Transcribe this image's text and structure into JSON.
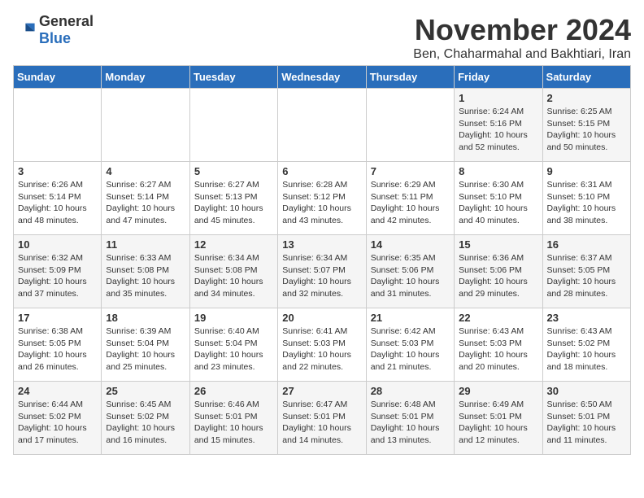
{
  "header": {
    "logo_general": "General",
    "logo_blue": "Blue",
    "title": "November 2024",
    "subtitle": "Ben, Chaharmahal and Bakhtiari, Iran"
  },
  "weekdays": [
    "Sunday",
    "Monday",
    "Tuesday",
    "Wednesday",
    "Thursday",
    "Friday",
    "Saturday"
  ],
  "weeks": [
    [
      {
        "day": "",
        "info": ""
      },
      {
        "day": "",
        "info": ""
      },
      {
        "day": "",
        "info": ""
      },
      {
        "day": "",
        "info": ""
      },
      {
        "day": "",
        "info": ""
      },
      {
        "day": "1",
        "info": "Sunrise: 6:24 AM\nSunset: 5:16 PM\nDaylight: 10 hours and 52 minutes."
      },
      {
        "day": "2",
        "info": "Sunrise: 6:25 AM\nSunset: 5:15 PM\nDaylight: 10 hours and 50 minutes."
      }
    ],
    [
      {
        "day": "3",
        "info": "Sunrise: 6:26 AM\nSunset: 5:14 PM\nDaylight: 10 hours and 48 minutes."
      },
      {
        "day": "4",
        "info": "Sunrise: 6:27 AM\nSunset: 5:14 PM\nDaylight: 10 hours and 47 minutes."
      },
      {
        "day": "5",
        "info": "Sunrise: 6:27 AM\nSunset: 5:13 PM\nDaylight: 10 hours and 45 minutes."
      },
      {
        "day": "6",
        "info": "Sunrise: 6:28 AM\nSunset: 5:12 PM\nDaylight: 10 hours and 43 minutes."
      },
      {
        "day": "7",
        "info": "Sunrise: 6:29 AM\nSunset: 5:11 PM\nDaylight: 10 hours and 42 minutes."
      },
      {
        "day": "8",
        "info": "Sunrise: 6:30 AM\nSunset: 5:10 PM\nDaylight: 10 hours and 40 minutes."
      },
      {
        "day": "9",
        "info": "Sunrise: 6:31 AM\nSunset: 5:10 PM\nDaylight: 10 hours and 38 minutes."
      }
    ],
    [
      {
        "day": "10",
        "info": "Sunrise: 6:32 AM\nSunset: 5:09 PM\nDaylight: 10 hours and 37 minutes."
      },
      {
        "day": "11",
        "info": "Sunrise: 6:33 AM\nSunset: 5:08 PM\nDaylight: 10 hours and 35 minutes."
      },
      {
        "day": "12",
        "info": "Sunrise: 6:34 AM\nSunset: 5:08 PM\nDaylight: 10 hours and 34 minutes."
      },
      {
        "day": "13",
        "info": "Sunrise: 6:34 AM\nSunset: 5:07 PM\nDaylight: 10 hours and 32 minutes."
      },
      {
        "day": "14",
        "info": "Sunrise: 6:35 AM\nSunset: 5:06 PM\nDaylight: 10 hours and 31 minutes."
      },
      {
        "day": "15",
        "info": "Sunrise: 6:36 AM\nSunset: 5:06 PM\nDaylight: 10 hours and 29 minutes."
      },
      {
        "day": "16",
        "info": "Sunrise: 6:37 AM\nSunset: 5:05 PM\nDaylight: 10 hours and 28 minutes."
      }
    ],
    [
      {
        "day": "17",
        "info": "Sunrise: 6:38 AM\nSunset: 5:05 PM\nDaylight: 10 hours and 26 minutes."
      },
      {
        "day": "18",
        "info": "Sunrise: 6:39 AM\nSunset: 5:04 PM\nDaylight: 10 hours and 25 minutes."
      },
      {
        "day": "19",
        "info": "Sunrise: 6:40 AM\nSunset: 5:04 PM\nDaylight: 10 hours and 23 minutes."
      },
      {
        "day": "20",
        "info": "Sunrise: 6:41 AM\nSunset: 5:03 PM\nDaylight: 10 hours and 22 minutes."
      },
      {
        "day": "21",
        "info": "Sunrise: 6:42 AM\nSunset: 5:03 PM\nDaylight: 10 hours and 21 minutes."
      },
      {
        "day": "22",
        "info": "Sunrise: 6:43 AM\nSunset: 5:03 PM\nDaylight: 10 hours and 20 minutes."
      },
      {
        "day": "23",
        "info": "Sunrise: 6:43 AM\nSunset: 5:02 PM\nDaylight: 10 hours and 18 minutes."
      }
    ],
    [
      {
        "day": "24",
        "info": "Sunrise: 6:44 AM\nSunset: 5:02 PM\nDaylight: 10 hours and 17 minutes."
      },
      {
        "day": "25",
        "info": "Sunrise: 6:45 AM\nSunset: 5:02 PM\nDaylight: 10 hours and 16 minutes."
      },
      {
        "day": "26",
        "info": "Sunrise: 6:46 AM\nSunset: 5:01 PM\nDaylight: 10 hours and 15 minutes."
      },
      {
        "day": "27",
        "info": "Sunrise: 6:47 AM\nSunset: 5:01 PM\nDaylight: 10 hours and 14 minutes."
      },
      {
        "day": "28",
        "info": "Sunrise: 6:48 AM\nSunset: 5:01 PM\nDaylight: 10 hours and 13 minutes."
      },
      {
        "day": "29",
        "info": "Sunrise: 6:49 AM\nSunset: 5:01 PM\nDaylight: 10 hours and 12 minutes."
      },
      {
        "day": "30",
        "info": "Sunrise: 6:50 AM\nSunset: 5:01 PM\nDaylight: 10 hours and 11 minutes."
      }
    ]
  ]
}
